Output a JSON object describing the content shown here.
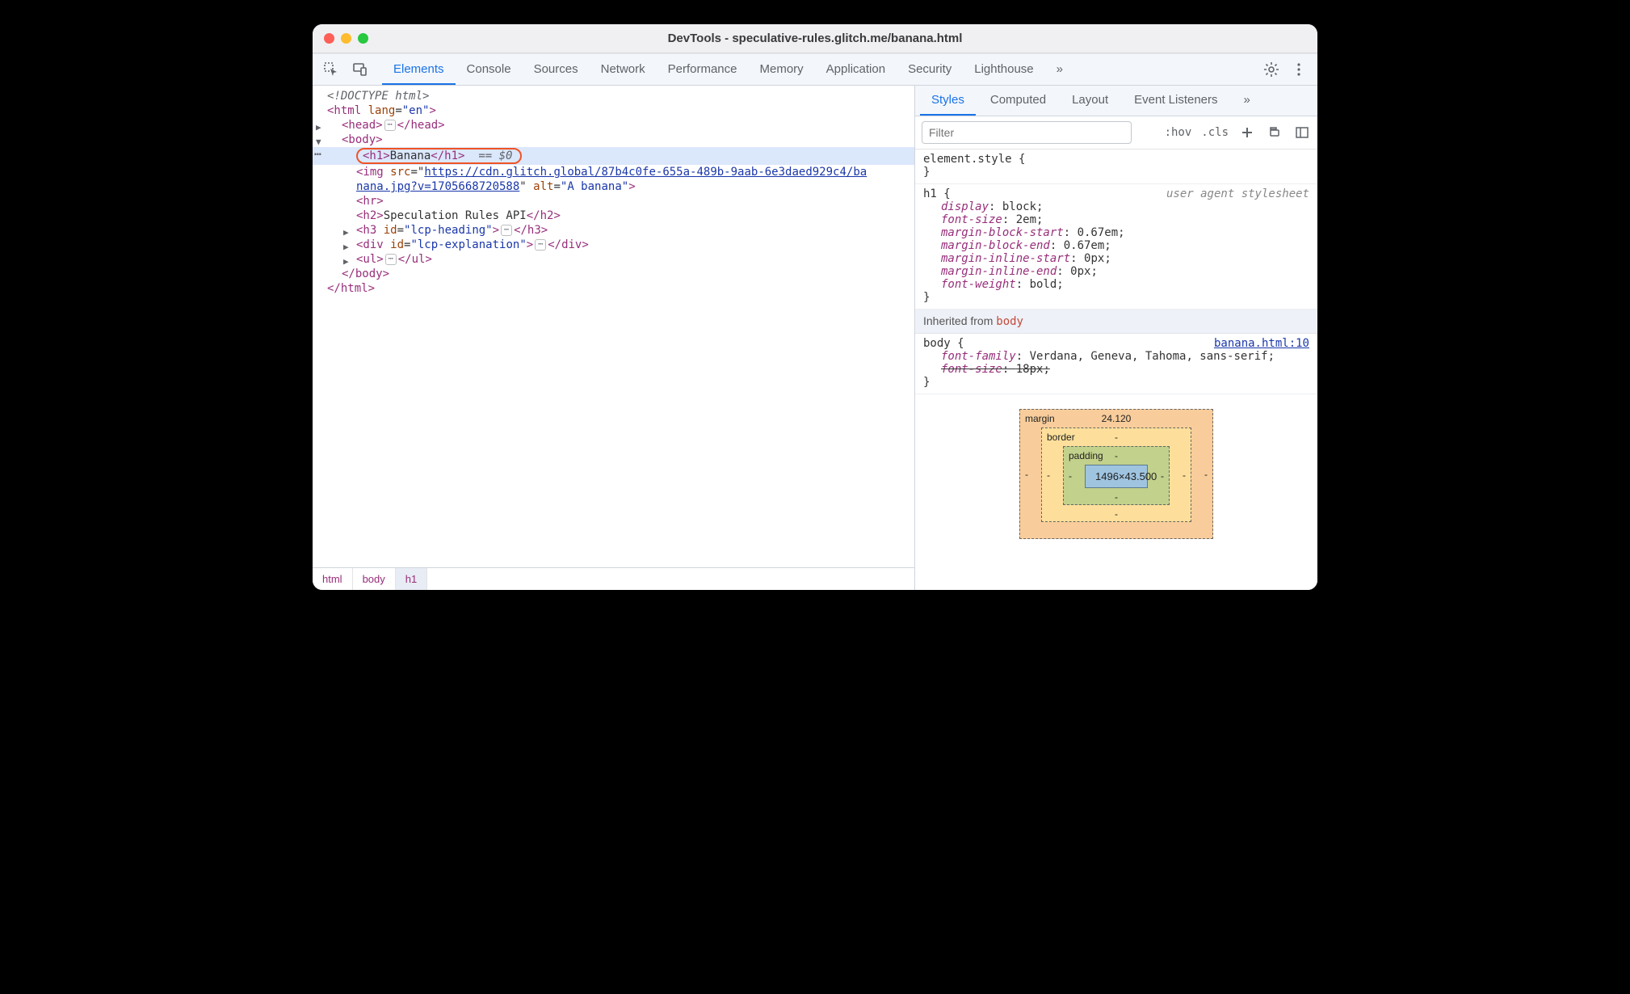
{
  "window": {
    "title": "DevTools - speculative-rules.glitch.me/banana.html"
  },
  "mainTabs": [
    "Elements",
    "Console",
    "Sources",
    "Network",
    "Performance",
    "Memory",
    "Application",
    "Security",
    "Lighthouse"
  ],
  "mainTabActive": "Elements",
  "sideTabs": [
    "Styles",
    "Computed",
    "Layout",
    "Event Listeners"
  ],
  "sideTabActive": "Styles",
  "filter": {
    "placeholder": "Filter",
    "hov": ":hov",
    "cls": ".cls"
  },
  "dom": {
    "doctype": "<!DOCTYPE html>",
    "htmlOpen": "<html lang=\"en\">",
    "headOpen": "<head>",
    "headClose": "</head>",
    "bodyOpen": "<body>",
    "bodyClose": "</body>",
    "h1": "<h1>Banana</h1>",
    "h1hint": "== $0",
    "imgLine1a": "<img src=\"",
    "imgUrl1": "https://cdn.glitch.global/87b4c0fe-655a-489b-9aab-6e3daed929c4/ba",
    "imgUrl2": "nana.jpg?v=1705668720588",
    "imgLine2b": "\" alt=\"A banana\">",
    "hr": "<hr>",
    "h2": "<h2>Speculation Rules API</h2>",
    "h3open": "<h3 id=\"lcp-heading\">",
    "h3close": "</h3>",
    "divopen": "<div id=\"lcp-explanation\">",
    "divclose": "</div>",
    "ulopen": "<ul>",
    "ulclose": "</ul>",
    "htmlClose": "</html>"
  },
  "breadcrumb": [
    "html",
    "body",
    "h1"
  ],
  "styles": {
    "elstyle": {
      "sel": "element.style",
      "props": []
    },
    "h1": {
      "sel": "h1",
      "source": "user agent stylesheet",
      "props": [
        {
          "n": "display",
          "v": "block"
        },
        {
          "n": "font-size",
          "v": "2em"
        },
        {
          "n": "margin-block-start",
          "v": "0.67em"
        },
        {
          "n": "margin-block-end",
          "v": "0.67em"
        },
        {
          "n": "margin-inline-start",
          "v": "0px"
        },
        {
          "n": "margin-inline-end",
          "v": "0px"
        },
        {
          "n": "font-weight",
          "v": "bold"
        }
      ]
    },
    "inheritLabel": "Inherited from",
    "inheritFrom": "body",
    "body": {
      "sel": "body",
      "source": "banana.html:10",
      "props": [
        {
          "n": "font-family",
          "v": "Verdana, Geneva, Tahoma, sans-serif",
          "strike": false
        },
        {
          "n": "font-size",
          "v": "18px",
          "strike": true
        }
      ]
    }
  },
  "boxmodel": {
    "marginLabel": "margin",
    "marginTop": "24.120",
    "borderLabel": "border",
    "paddingLabel": "padding",
    "content": "1496×43.500",
    "dash": "-"
  }
}
